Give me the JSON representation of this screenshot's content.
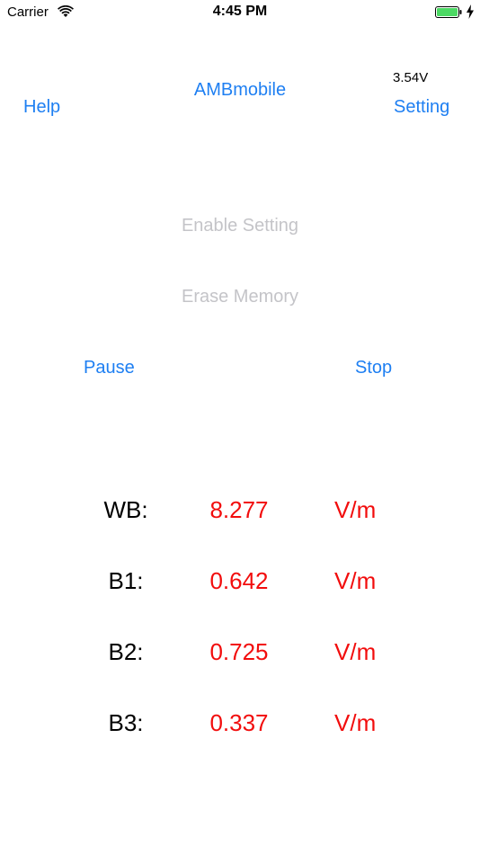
{
  "status_bar": {
    "carrier": "Carrier",
    "time": "4:45 PM",
    "battery_color": "#4cd964"
  },
  "header": {
    "help_label": "Help",
    "title": "AMBmobile",
    "voltage": "3.54V",
    "setting_label": "Setting"
  },
  "controls": {
    "enable_setting_label": "Enable Setting",
    "erase_memory_label": "Erase Memory",
    "pause_label": "Pause",
    "stop_label": "Stop"
  },
  "readings": [
    {
      "label": "WB:",
      "value": "8.277",
      "unit": "V/m"
    },
    {
      "label": "B1:",
      "value": "0.642",
      "unit": "V/m"
    },
    {
      "label": "B2:",
      "value": "0.725",
      "unit": "V/m"
    },
    {
      "label": "B3:",
      "value": "0.337",
      "unit": "V/m"
    }
  ],
  "colors": {
    "accent": "#1e7ff2",
    "value_red": "#f20d0d",
    "disabled": "#c4c4c8"
  }
}
